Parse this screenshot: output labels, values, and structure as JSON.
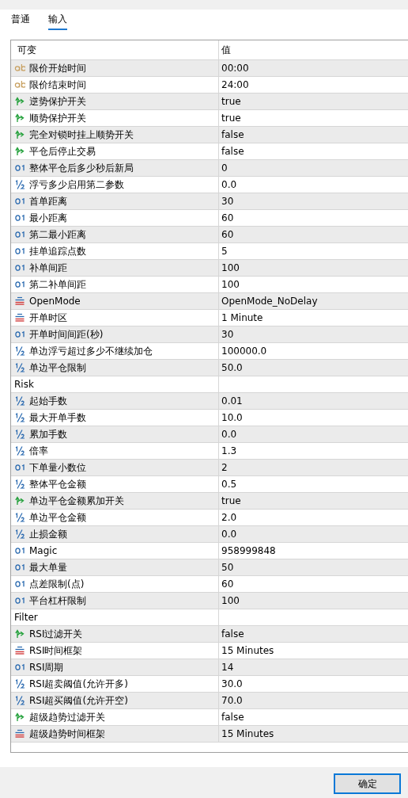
{
  "tabs": [
    {
      "label": "普通",
      "selected": false
    },
    {
      "label": "输入",
      "selected": true
    }
  ],
  "table": {
    "columns": [
      "可变",
      "值"
    ],
    "rows": [
      {
        "kind": "string",
        "name": "限价开始时间",
        "value": "00:00"
      },
      {
        "kind": "string",
        "name": "限价结束时间",
        "value": "24:00"
      },
      {
        "kind": "bool",
        "name": "逆势保护开关",
        "value": "true"
      },
      {
        "kind": "bool",
        "name": "顺势保护开关",
        "value": "true"
      },
      {
        "kind": "bool",
        "name": "完全对锁时挂上顺势开关",
        "value": "false"
      },
      {
        "kind": "bool",
        "name": "平仓后停止交易",
        "value": "false"
      },
      {
        "kind": "int",
        "name": "整体平仓后多少秒后新局",
        "value": "0"
      },
      {
        "kind": "double",
        "name": "浮亏多少启用第二参数",
        "value": "0.0"
      },
      {
        "kind": "int",
        "name": "首单距离",
        "value": "30"
      },
      {
        "kind": "int",
        "name": "最小距离",
        "value": "60"
      },
      {
        "kind": "int",
        "name": "第二最小距离",
        "value": "60"
      },
      {
        "kind": "int",
        "name": "挂单追踪点数",
        "value": "5"
      },
      {
        "kind": "int",
        "name": "补单间距",
        "value": "100"
      },
      {
        "kind": "int",
        "name": "第二补单间距",
        "value": "100"
      },
      {
        "kind": "enum",
        "name": "OpenMode",
        "value": "OpenMode_NoDelay"
      },
      {
        "kind": "enum",
        "name": "开单时区",
        "value": "1 Minute"
      },
      {
        "kind": "int",
        "name": "开单时间间距(秒)",
        "value": "30"
      },
      {
        "kind": "double",
        "name": "单边浮亏超过多少不继续加仓",
        "value": "100000.0"
      },
      {
        "kind": "double",
        "name": "单边平仓限制",
        "value": "50.0"
      },
      {
        "kind": "group",
        "name": "Risk"
      },
      {
        "kind": "double",
        "name": "起始手数",
        "value": "0.01"
      },
      {
        "kind": "double",
        "name": "最大开单手数",
        "value": "10.0"
      },
      {
        "kind": "double",
        "name": "累加手数",
        "value": "0.0"
      },
      {
        "kind": "double",
        "name": "倍率",
        "value": "1.3"
      },
      {
        "kind": "int",
        "name": "下单量小数位",
        "value": "2"
      },
      {
        "kind": "double",
        "name": "整体平仓金额",
        "value": "0.5"
      },
      {
        "kind": "bool",
        "name": "单边平仓金额累加开关",
        "value": "true"
      },
      {
        "kind": "double",
        "name": "单边平仓金额",
        "value": "2.0"
      },
      {
        "kind": "double",
        "name": "止损金额",
        "value": "0.0"
      },
      {
        "kind": "int",
        "name": "Magic",
        "value": "958999848"
      },
      {
        "kind": "int",
        "name": "最大单量",
        "value": "50"
      },
      {
        "kind": "int",
        "name": "点差限制(点)",
        "value": "60"
      },
      {
        "kind": "int",
        "name": "平台杠杆限制",
        "value": "100"
      },
      {
        "kind": "group",
        "name": "Filter"
      },
      {
        "kind": "bool",
        "name": "RSI过滤开关",
        "value": "false"
      },
      {
        "kind": "enum",
        "name": "RSI时间框架",
        "value": "15 Minutes"
      },
      {
        "kind": "int",
        "name": "RSI周期",
        "value": "14"
      },
      {
        "kind": "double",
        "name": "RSI超卖阈值(允许开多)",
        "value": "30.0"
      },
      {
        "kind": "double",
        "name": "RSI超买阈值(允许开空)",
        "value": "70.0"
      },
      {
        "kind": "bool",
        "name": "超级趋势过滤开关",
        "value": "false"
      },
      {
        "kind": "enum",
        "name": "超级趋势时间框架",
        "value": "15 Minutes"
      }
    ]
  },
  "buttons": [
    {
      "label": "确定"
    }
  ]
}
